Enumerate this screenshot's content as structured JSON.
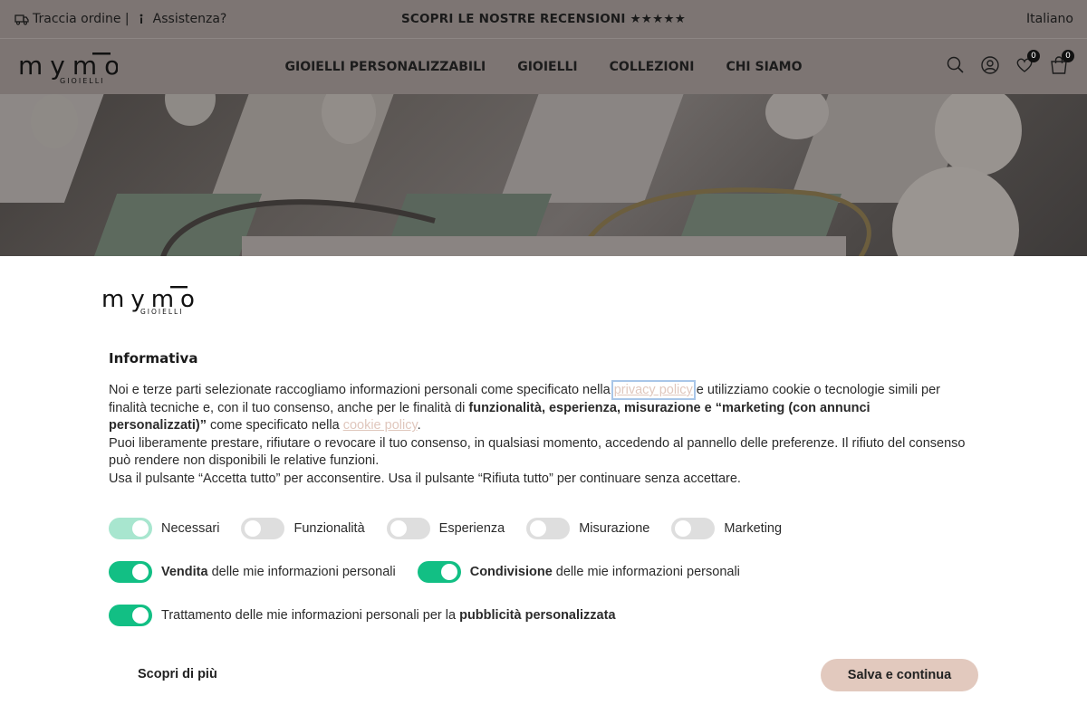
{
  "topbar": {
    "track_order": "Traccia ordine |",
    "support": "Assistenza?",
    "reviews": "SCOPRI LE NOSTRE RECENSIONI ★★★★★",
    "language": "Italiano"
  },
  "header": {
    "logo_text": "mymō",
    "logo_sub": "GIOIELLI",
    "nav": [
      "GIOIELLI PERSONALIZZABILI",
      "GIOIELLI",
      "COLLEZIONI",
      "CHI SIAMO"
    ],
    "wishlist_count": "0",
    "cart_count": "0"
  },
  "cookie": {
    "logo_text": "mymō",
    "logo_sub": "GIOIELLI",
    "title": "Informativa",
    "p1_a": "Noi e terze parti selezionate raccogliamo informazioni personali come specificato nella ",
    "privacy_link": "privacy policy",
    "p1_b": " e utilizziamo cookie o tecnologie simili per finalità tecniche e, con il tuo consenso, anche per le finalità di ",
    "p1_bold": "funzionalità, esperienza, misurazione e “marketing (con annunci personalizzati)”",
    "p1_c": " come specificato nella ",
    "cookie_link": "cookie policy",
    "p1_d": ".",
    "p2": "Puoi liberamente prestare, rifiutare o revocare il tuo consenso, in qualsiasi momento, accedendo al pannello delle preferenze. Il rifiuto del consenso può rendere non disponibili le relative funzioni.",
    "p3": "Usa il pulsante “Accetta tutto” per acconsentire. Usa il pulsante “Rifiuta tutto” per continuare senza accettare.",
    "toggles": {
      "necessari": "Necessari",
      "funzionalita": "Funzionalità",
      "esperienza": "Esperienza",
      "misurazione": "Misurazione",
      "marketing": "Marketing"
    },
    "vendita_bold": "Vendita",
    "vendita_rest": " delle mie informazioni personali",
    "condivisione_bold": "Condivisione",
    "condivisione_rest": " delle mie informazioni personali",
    "trattamento_rest": "Trattamento delle mie informazioni personali per la ",
    "trattamento_bold": "pubblicità personalizzata",
    "more_button": "Scopri di più",
    "save_button": "Salva e continua"
  },
  "colors": {
    "topbar_bg": "#7d7573",
    "toggle_on": "#12bf84",
    "toggle_disabled": "#a8e6cf",
    "save_button": "#e2c9be",
    "link": "#e0c7bd"
  }
}
